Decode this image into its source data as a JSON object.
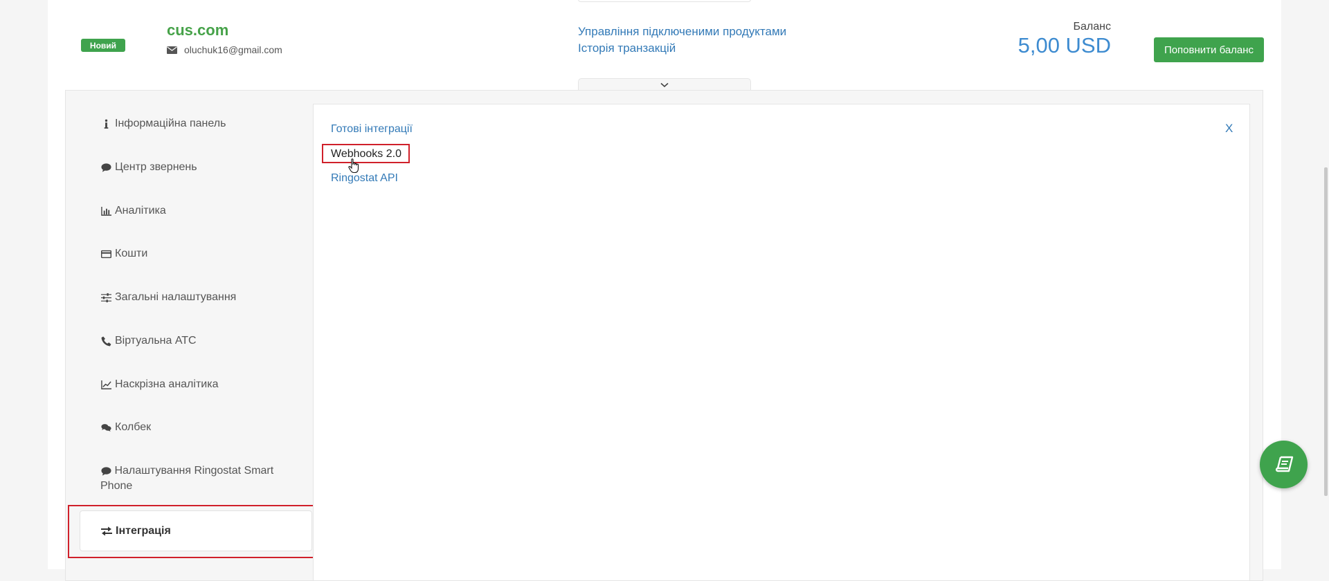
{
  "header": {
    "badge": "Новий",
    "account_name": "cus.com",
    "email": "oluchuk16@gmail.com",
    "links": [
      "Управління підключеними продуктами",
      "Історія транзакцій"
    ],
    "balance_label": "Баланс",
    "balance_value": "5,00 USD",
    "topup_label": "Поповнити баланс"
  },
  "sidebar": {
    "items": [
      {
        "label": "Інформаційна панель",
        "icon": "info-icon"
      },
      {
        "label": "Центр звернень",
        "icon": "comment-icon"
      },
      {
        "label": "Аналітика",
        "icon": "bar-chart-icon"
      },
      {
        "label": "Кошти",
        "icon": "credit-card-icon"
      },
      {
        "label": "Загальні налаштування",
        "icon": "sliders-icon"
      },
      {
        "label": "Віртуальна АТС",
        "icon": "phone-icon"
      },
      {
        "label": "Наскрізна аналітика",
        "icon": "line-chart-icon"
      },
      {
        "label": "Колбек",
        "icon": "comments-icon"
      },
      {
        "label": "Налаштування Ringostat Smart Phone",
        "icon": "comment-icon"
      }
    ],
    "active": {
      "label": "Інтеграція",
      "icon": "exchange-icon"
    }
  },
  "content": {
    "links": [
      "Готові інтеграції",
      "Webhooks 2.0",
      "Ringostat API"
    ],
    "close_label": "X"
  },
  "colors": {
    "green": "#3fa34d",
    "link": "#337ab7",
    "highlight": "#d0202a"
  }
}
